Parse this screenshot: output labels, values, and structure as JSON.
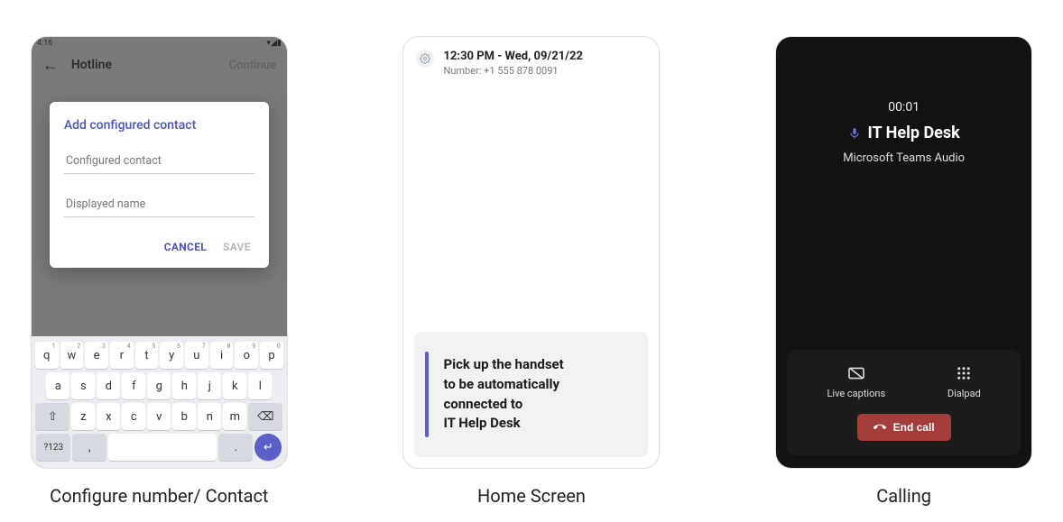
{
  "captions": {
    "configure": "Configure number/ Contact",
    "home": "Home Screen",
    "calling": "Calling"
  },
  "screen1": {
    "status_time": "4:16",
    "header_title": "Hotline",
    "header_continue": "Continue",
    "dialog": {
      "title": "Add configured contact",
      "field1_placeholder": "Configured contact",
      "field2_placeholder": "Displayed name",
      "cancel": "CANCEL",
      "save": "SAVE"
    },
    "keyboard": {
      "row1": [
        {
          "k": "q",
          "n": "1"
        },
        {
          "k": "w",
          "n": "2"
        },
        {
          "k": "e",
          "n": "3"
        },
        {
          "k": "r",
          "n": "4"
        },
        {
          "k": "t",
          "n": "5"
        },
        {
          "k": "y",
          "n": "6"
        },
        {
          "k": "u",
          "n": "7"
        },
        {
          "k": "i",
          "n": "8"
        },
        {
          "k": "o",
          "n": "9"
        },
        {
          "k": "p",
          "n": "0"
        }
      ],
      "row2": [
        "a",
        "s",
        "d",
        "f",
        "g",
        "h",
        "j",
        "k",
        "l"
      ],
      "row3": [
        "z",
        "x",
        "c",
        "v",
        "b",
        "n",
        "m"
      ],
      "shift_icon": "⇧",
      "backspace_icon": "⌫",
      "num_key": "?123",
      "comma": ",",
      "period": ".",
      "enter_icon": "↵"
    }
  },
  "screen2": {
    "datetime": "12:30 PM - Wed, 09/21/22",
    "number_label": "Number: +1 555 878 0091",
    "card_line1": "Pick up the handset",
    "card_line2": "to be automatically",
    "card_line3": "connected to",
    "card_line4": "IT Help Desk"
  },
  "screen3": {
    "timer": "00:01",
    "title": "IT Help Desk",
    "audio_line": "Microsoft Teams Audio",
    "live_captions": "Live captions",
    "dialpad": "Dialpad",
    "end_call": "End call"
  }
}
